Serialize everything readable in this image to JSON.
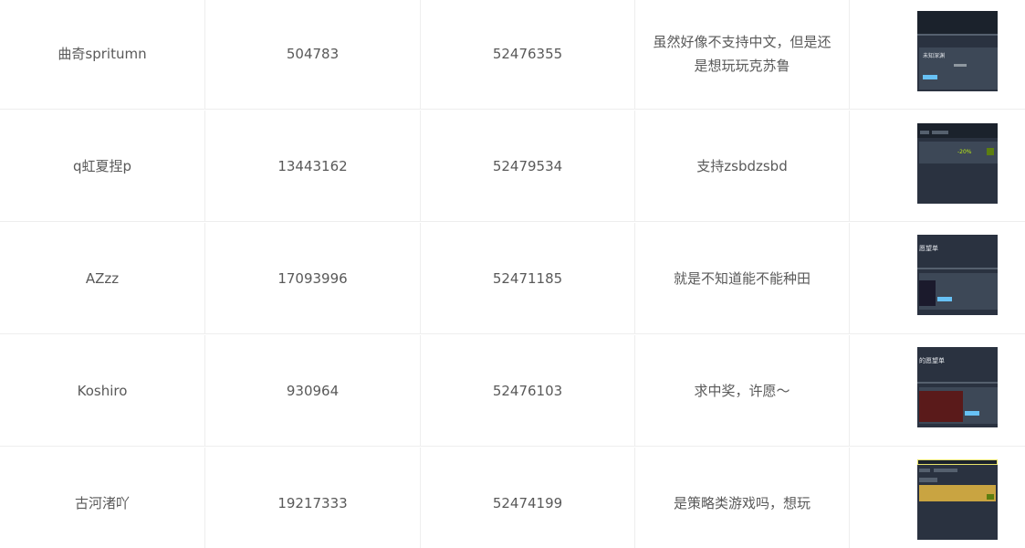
{
  "rows": [
    {
      "name": "曲奇spritumn",
      "uid": "504783",
      "order": "52476355",
      "comment": "虽然好像不支持中文，但是还是想玩玩克苏鲁",
      "thumb_icon": "steam-wishlist-screenshot",
      "thumb_text": "未知深渊"
    },
    {
      "name": "q虹夏捏p",
      "uid": "13443162",
      "order": "52479534",
      "comment": "支持zsbdzsbd",
      "thumb_icon": "steam-wishlist-screenshot",
      "thumb_text": "-20%"
    },
    {
      "name": "AZzz",
      "uid": "17093996",
      "order": "52471185",
      "comment": "就是不知道能不能种田",
      "thumb_icon": "steam-wishlist-screenshot",
      "thumb_text": "愿望单"
    },
    {
      "name": "Koshiro",
      "uid": "930964",
      "order": "52476103",
      "comment": "求中奖，许愿～",
      "thumb_icon": "steam-wishlist-screenshot",
      "thumb_text": "的愿望单"
    },
    {
      "name": "古河渚吖",
      "uid": "19217333",
      "order": "52474199",
      "comment": "是策略类游戏吗，想玩",
      "thumb_icon": "steam-wishlist-screenshot",
      "thumb_text": ""
    }
  ],
  "colors": {
    "thumb_bg": "#2a3240",
    "thumb_panel": "#3d4857",
    "thumb_accent": "#67c1f5",
    "thumb_green": "#5c7e10",
    "thumb_gold": "#c9a441"
  }
}
